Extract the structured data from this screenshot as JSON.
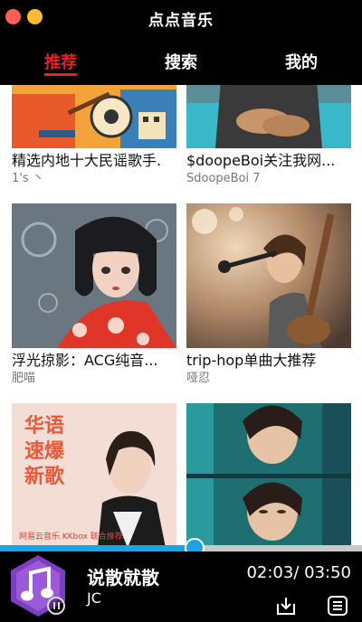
{
  "window": {
    "title": "点点音乐"
  },
  "tabs": [
    {
      "label": "推荐",
      "active": true
    },
    {
      "label": "搜索",
      "active": false
    },
    {
      "label": "我的",
      "active": false
    }
  ],
  "playlists": [
    {
      "title": "精选内地十大民谣歌手.",
      "subtitle": "1's 丶"
    },
    {
      "title": "$doopeBoi关注我网...",
      "subtitle": "SdoopeBoi 7"
    },
    {
      "title": "浮光掠影：ACG纯音...",
      "subtitle": "肥喵"
    },
    {
      "title": "trip-hop单曲大推荐",
      "subtitle": "哑忍"
    },
    {
      "title": "",
      "subtitle": "",
      "cover_text": [
        "华语",
        "速爆",
        "新歌"
      ],
      "cover_footer": "网易云音乐 KKbox 联合推荐"
    },
    {
      "title": "",
      "subtitle": ""
    }
  ],
  "player": {
    "song": "说散就散",
    "artist": "JC",
    "time": "02:03/ 03:50",
    "progress": 0.535
  },
  "colors": {
    "accent": "#e8202a",
    "progress": "#1fa1e8",
    "cover_purple": "#7b3fc0"
  }
}
